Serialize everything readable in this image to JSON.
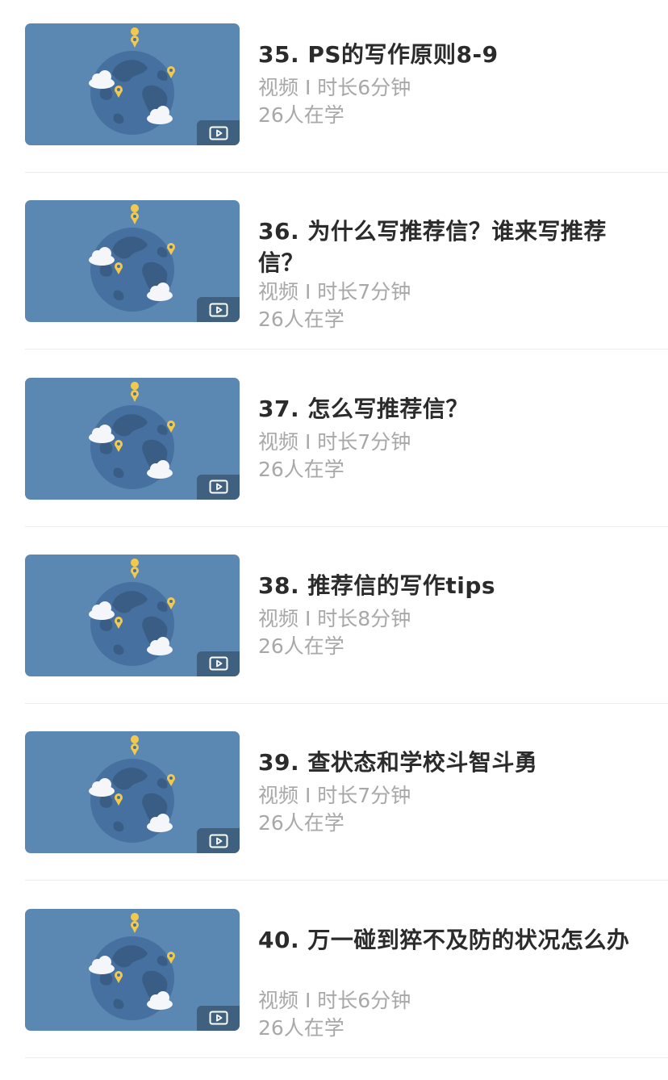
{
  "lessons": [
    {
      "title": "35. PS的写作原则8-9",
      "type": "视频",
      "duration": "时长6分钟",
      "learners": "26人在学"
    },
    {
      "title": "36. 为什么写推荐信？谁来写推荐信？",
      "type": "视频",
      "duration": "时长7分钟",
      "learners": "26人在学"
    },
    {
      "title": "37. 怎么写推荐信？",
      "type": "视频",
      "duration": "时长7分钟",
      "learners": "26人在学"
    },
    {
      "title": "38. 推荐信的写作tips",
      "type": "视频",
      "duration": "时长8分钟",
      "learners": "26人在学"
    },
    {
      "title": "39. 查状态和学校斗智斗勇",
      "type": "视频",
      "duration": "时长7分钟",
      "learners": "26人在学"
    },
    {
      "title": "40. 万一碰到猝不及防的状况怎么办",
      "type": "视频",
      "duration": "时长6分钟",
      "learners": "26人在学"
    }
  ],
  "separator": " I ",
  "icons": {
    "thumbnail": "globe-icon",
    "badge": "video-play-icon"
  },
  "colors": {
    "thumbnail_bg": "#5b87b3",
    "globe": "#46709f",
    "land": "#3a5d85",
    "pin": "#f2c94c",
    "title": "#2b2b2b",
    "meta": "#a8a8a8"
  }
}
